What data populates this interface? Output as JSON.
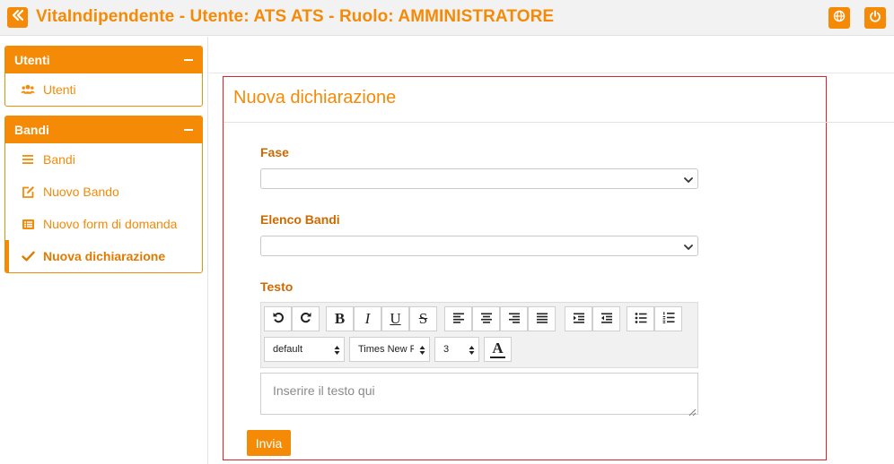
{
  "header": {
    "title": "VitaIndipendente - Utente: ATS ATS - Ruolo: AMMINISTRATORE",
    "icons": [
      "double-chevron-left-icon",
      "globe-icon",
      "power-icon"
    ]
  },
  "sidebar": {
    "panels": [
      {
        "title": "Utenti",
        "items": [
          {
            "label": "Utenti",
            "icon": "users-icon"
          }
        ]
      },
      {
        "title": "Bandi",
        "items": [
          {
            "label": "Bandi",
            "icon": "list-icon"
          },
          {
            "label": "Nuovo Bando",
            "icon": "edit-icon"
          },
          {
            "label": "Nuovo form di domanda",
            "icon": "form-list-icon"
          },
          {
            "label": "Nuova dichiarazione",
            "icon": "check-icon",
            "active": true
          }
        ]
      }
    ]
  },
  "form": {
    "title": "Nuova dichiarazione",
    "fase": {
      "label": "Fase",
      "value": ""
    },
    "elenco_bandi": {
      "label": "Elenco Bandi",
      "value": ""
    },
    "testo": {
      "label": "Testo",
      "placeholder": "Inserire il testo qui",
      "toolbar": {
        "buttons": [
          "undo",
          "redo",
          "bold",
          "italic",
          "underline",
          "strikethrough",
          "align-left",
          "align-center",
          "align-right",
          "justify",
          "indent",
          "outdent",
          "bullet-list",
          "numbered-list"
        ],
        "bold_glyph": "B",
        "italic_glyph": "I",
        "underline_glyph": "U",
        "strike_glyph": "S",
        "font_color_glyph": "A",
        "style_select": "default",
        "font_select": "Times New R",
        "size_select": "3"
      }
    },
    "submit_label": "Invia"
  },
  "colors": {
    "accent": "#f58a07",
    "label": "#cc6a00",
    "card_border": "#d9232e"
  }
}
